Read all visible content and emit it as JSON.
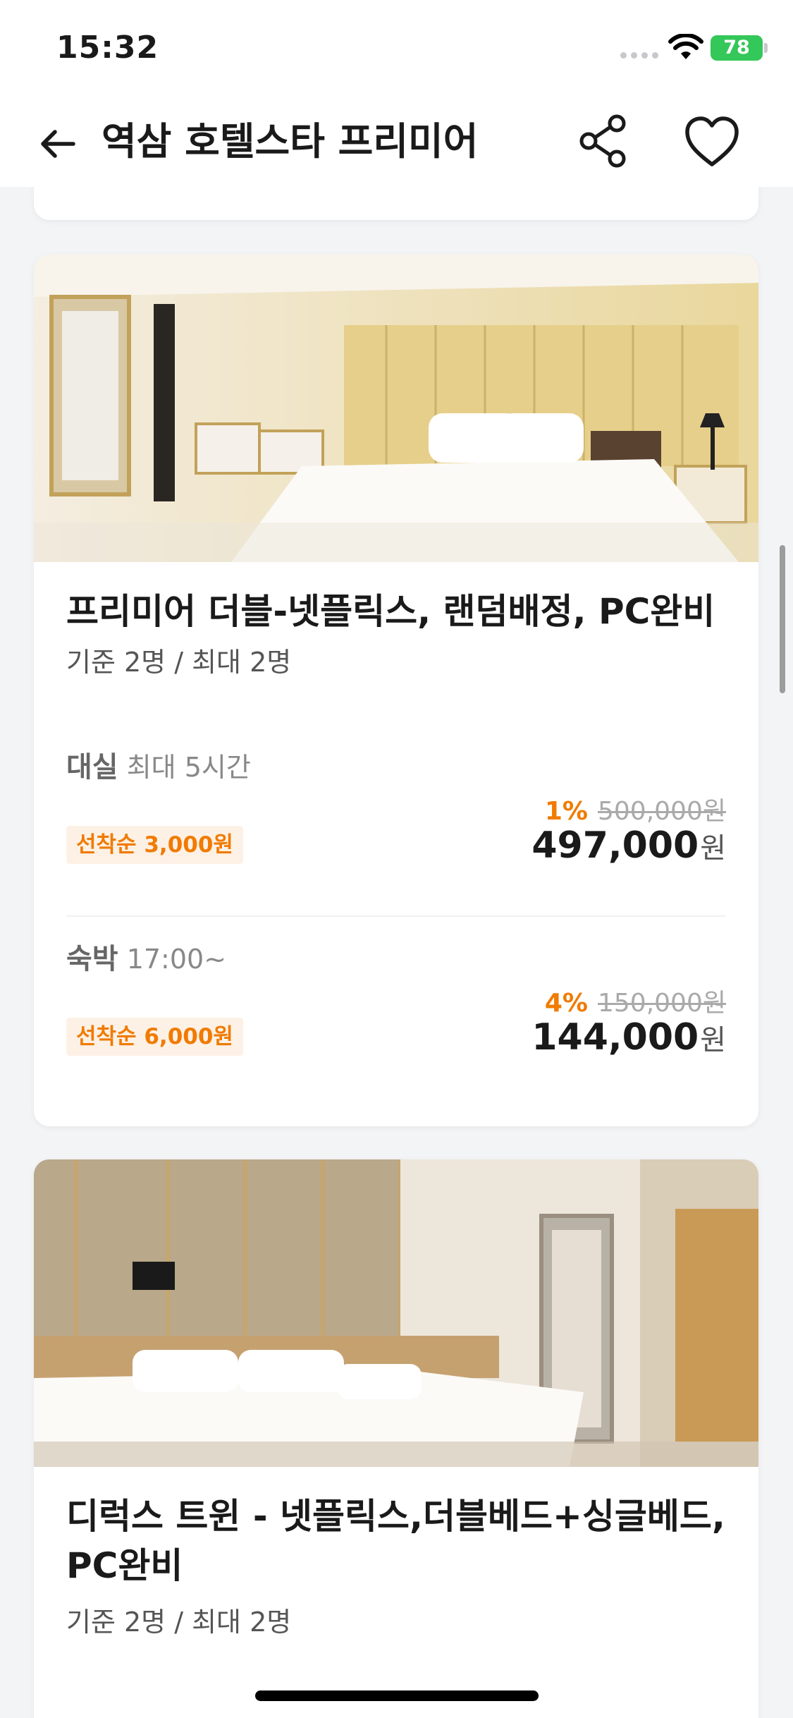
{
  "status_bar": {
    "time": "15:32",
    "battery": "78"
  },
  "header": {
    "title": "역삼 호텔스타 프리미어"
  },
  "rooms": [
    {
      "name": "프리미어 더블-넷플릭스, 랜덤배정, PC완비",
      "capacity": "기준 2명 / 최대 2명",
      "rates": [
        {
          "type": "대실",
          "detail": "최대 5시간",
          "coupon": "선착순 3,000원",
          "discount": "1%",
          "original_price": "500,000원",
          "price": "497,000",
          "currency": "원"
        },
        {
          "type": "숙박",
          "detail": "17:00~",
          "coupon": "선착순 6,000원",
          "discount": "4%",
          "original_price": "150,000원",
          "price": "144,000",
          "currency": "원"
        }
      ]
    },
    {
      "name_line1": "디럭스 트윈 - 넷플릭스,더블베드+싱글베드,",
      "name_line2": "PC완비",
      "capacity": "기준 2명 / 최대 2명"
    }
  ]
}
